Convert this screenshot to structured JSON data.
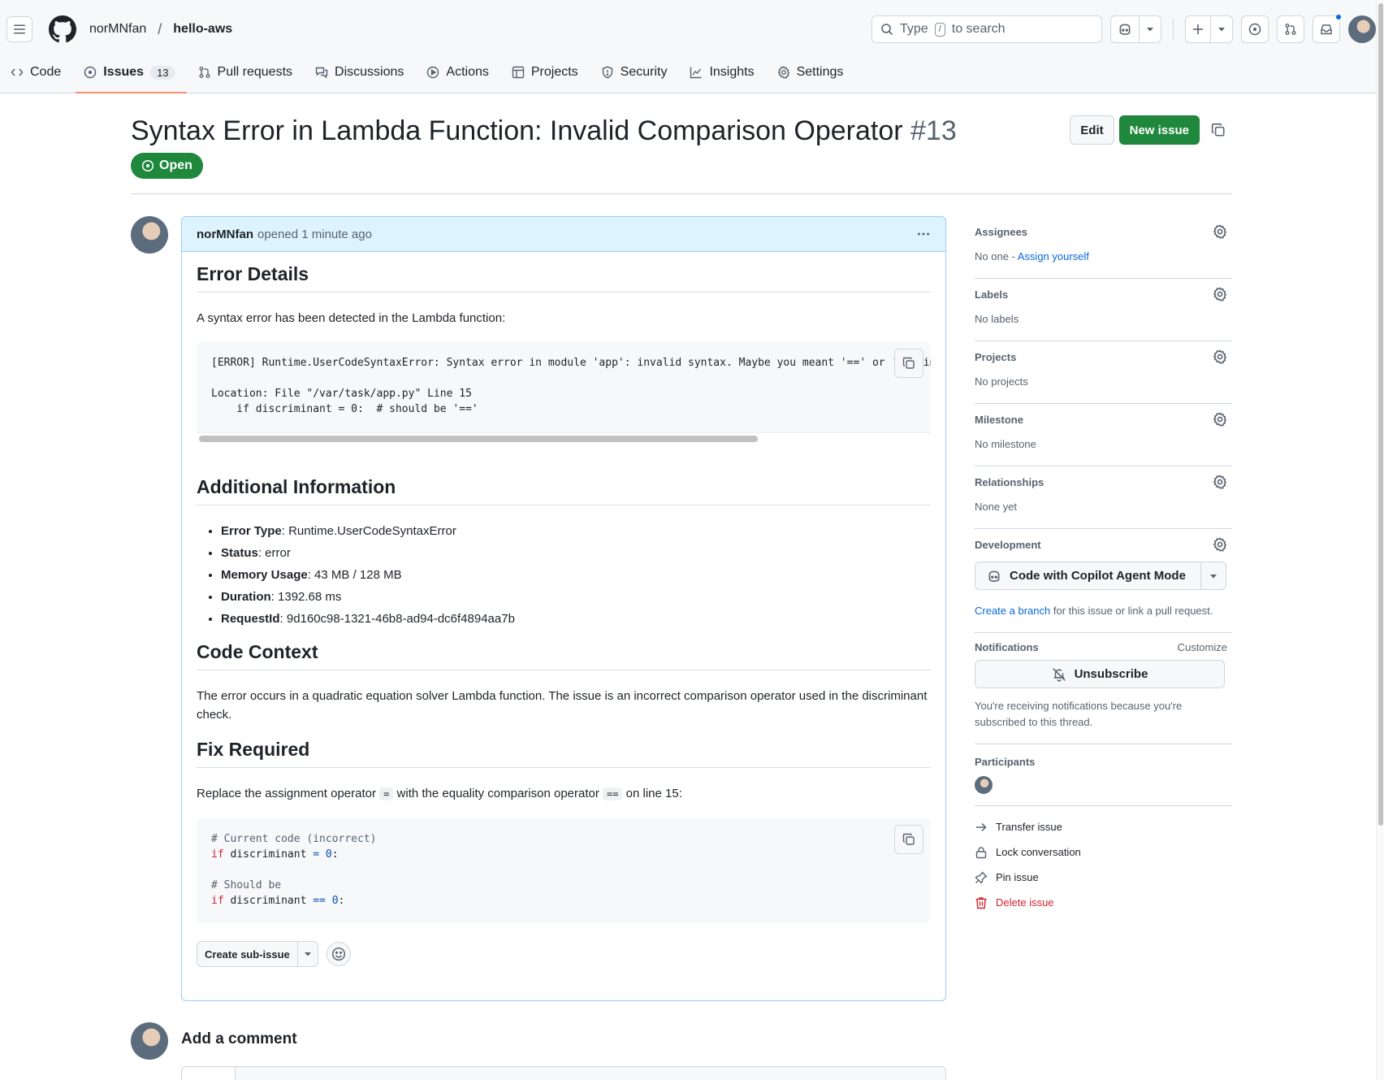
{
  "header": {
    "owner": "norMNfan",
    "repo": "hello-aws",
    "search_prefix": "Type",
    "search_key": "/",
    "search_suffix": "to search"
  },
  "repo_nav": [
    {
      "label": "Code"
    },
    {
      "label": "Issues",
      "count": "13"
    },
    {
      "label": "Pull requests"
    },
    {
      "label": "Discussions"
    },
    {
      "label": "Actions"
    },
    {
      "label": "Projects"
    },
    {
      "label": "Security"
    },
    {
      "label": "Insights"
    },
    {
      "label": "Settings"
    }
  ],
  "issue": {
    "title": "Syntax Error in Lambda Function: Invalid Comparison Operator",
    "number": "#13",
    "state": "Open",
    "edit_label": "Edit",
    "new_issue_label": "New issue"
  },
  "comment": {
    "author": "norMNfan",
    "opened": "opened",
    "time": "1 minute ago",
    "h_error_details": "Error Details",
    "p_detected": "A syntax error has been detected in the Lambda function:",
    "code1": "[ERROR] Runtime.UserCodeSyntaxError: Syntax error in module 'app': invalid syntax. Maybe you meant '==' or ':=' instead of '='?\n\nLocation: File \"/var/task/app.py\" Line 15\n    if discriminant = 0:  # should be '=='",
    "h_additional": "Additional Information",
    "info": [
      {
        "key": "Error Type",
        "value": ": Runtime.UserCodeSyntaxError"
      },
      {
        "key": "Status",
        "value": ": error"
      },
      {
        "key": "Memory Usage",
        "value": ": 43 MB / 128 MB"
      },
      {
        "key": "Duration",
        "value": ": 1392.68 ms"
      },
      {
        "key": "RequestId",
        "value": ": 9d160c98-1321-46b8-ad94-dc6f4894aa7b"
      }
    ],
    "h_context": "Code Context",
    "p_context": "The error occurs in a quadratic equation solver Lambda function. The issue is an incorrect comparison operator used in the discriminant check.",
    "h_fix": "Fix Required",
    "fix_prefix": "Replace the assignment operator",
    "fix_op1": "=",
    "fix_middle": "with the equality comparison operator",
    "fix_op2": "==",
    "fix_suffix": "on line 15:",
    "code2": {
      "c1": "# Current code (incorrect)",
      "kw": "if",
      "var": " discriminant ",
      "op1": "=",
      "num": "0",
      "colon": ":",
      "c2": "# Should be",
      "op2": "=="
    },
    "create_sub_issue": "Create sub-issue"
  },
  "add_comment": {
    "title": "Add a comment"
  },
  "sidebar": {
    "assignees": {
      "label": "Assignees",
      "none": "No one - ",
      "assign": "Assign yourself"
    },
    "labels": {
      "label": "Labels",
      "value": "No labels"
    },
    "projects": {
      "label": "Projects",
      "value": "No projects"
    },
    "milestone": {
      "label": "Milestone",
      "value": "No milestone"
    },
    "relationships": {
      "label": "Relationships",
      "value": "None yet"
    },
    "development": {
      "label": "Development",
      "copilot_button": "Code with Copilot Agent Mode",
      "create_branch": "Create a branch",
      "rest": " for this issue or link a pull request."
    },
    "notifications": {
      "label": "Notifications",
      "customize": "Customize",
      "unsubscribe": "Unsubscribe",
      "note": "You're receiving notifications because you're subscribed to this thread."
    },
    "participants": {
      "label": "Participants"
    },
    "actions": {
      "transfer": "Transfer issue",
      "lock": "Lock conversation",
      "pin": "Pin issue",
      "delete": "Delete issue"
    }
  },
  "colors": {
    "primary_green": "#1f883d",
    "link_blue": "#0969da",
    "danger_red": "#d1242f",
    "nav_underline": "#fd8c73",
    "comment_header_bg": "#ddf4ff"
  }
}
